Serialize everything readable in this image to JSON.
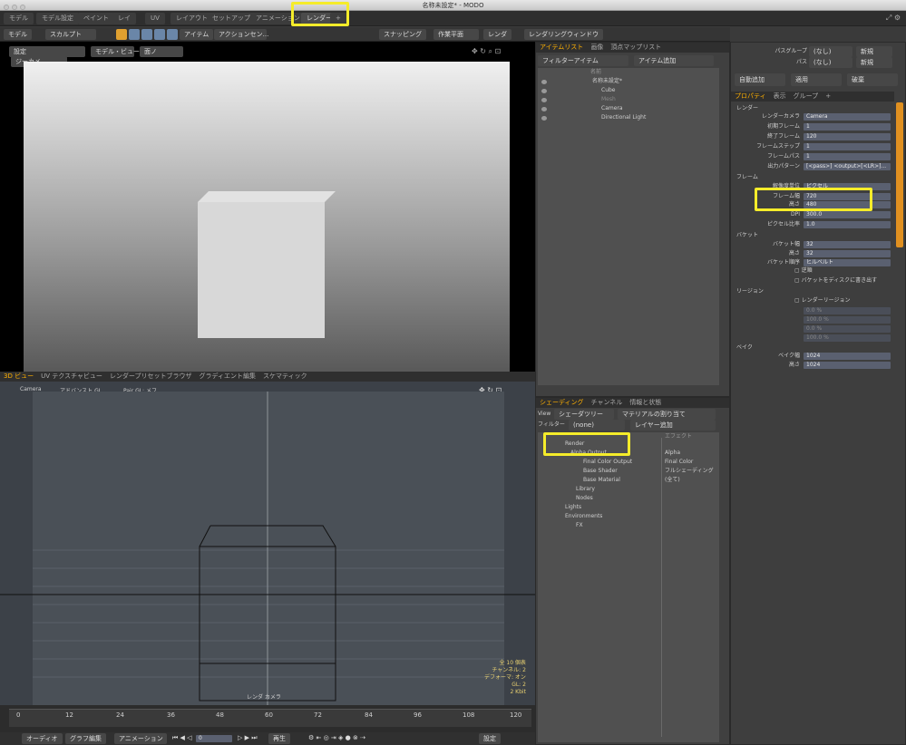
{
  "window": {
    "title": "名称未設定* - MODO"
  },
  "menu_tabs": [
    "モデル",
    "モデル設定",
    "ペイント",
    "レイ",
    "UV",
    "レイアウト",
    "セットアップ",
    "アニメーション",
    "レンダー",
    "+"
  ],
  "toolbar": {
    "model": "モデル",
    "sculpt": "スカルプト",
    "item": "アイテム",
    "action": "アクションセン...",
    "stepping": "スナッピング",
    "workplane": "作業平面",
    "render": "レンダ",
    "render_window": "レンダリングウィンドウ"
  },
  "viewport_top": {
    "tabs": [
      "設定",
      "モデル・ビュー",
      "面ノ",
      "ジーカメ"
    ]
  },
  "viewport_bottom": {
    "tabs": [
      "3D ビュー",
      "UV テクスチャビュー",
      "レンダープリセットブラウザ",
      "グラディエント編集",
      "スケマティック"
    ],
    "camera": "Camera",
    "mode": "アドバンスト GL",
    "fps": "Pair GL: メフ",
    "label": "レンダ カメラ",
    "info": [
      "全 10 個表",
      "チャンネル: 2",
      "デフォーマ: オン",
      "GL: 2",
      "2 Kbit"
    ]
  },
  "timeline": {
    "ticks": [
      "0",
      "12",
      "24",
      "36",
      "48",
      "60",
      "72",
      "84",
      "96",
      "108",
      "120"
    ],
    "controls": {
      "audio": "オーディオ",
      "graph": "グラフ編集",
      "animation": "アニメーション",
      "frame": "0",
      "play": "再生",
      "settings": "設定"
    }
  },
  "item_list": {
    "tabs": [
      "アイテムリスト",
      "画像",
      "頂点マップリスト"
    ],
    "filter": "フィルターアイテム",
    "add": "アイテム追加",
    "header": "名前",
    "items": [
      "名称未設定*",
      "Cube",
      "Mesh",
      "Camera",
      "Directional Light"
    ]
  },
  "shading": {
    "tabs": [
      "シェーディング",
      "チャンネル",
      "情報と状態"
    ],
    "view_label": "View",
    "view_value": "シェーダツリー",
    "assign": "マテリアルの割り当て",
    "filter_label": "フィルター",
    "filter_value": "(none)",
    "add_layer": "レイヤー追加",
    "effect_header": "エフェクト",
    "items": [
      {
        "name": "Render",
        "effect": ""
      },
      {
        "name": "Alpha Output",
        "effect": "Alpha"
      },
      {
        "name": "Final Color Output",
        "effect": "Final Color"
      },
      {
        "name": "Base Shader",
        "effect": "フルシェーディング"
      },
      {
        "name": "Base Material",
        "effect": "(全て)"
      },
      {
        "name": "Library",
        "effect": ""
      },
      {
        "name": "Nodes",
        "effect": ""
      },
      {
        "name": "Lights",
        "effect": ""
      },
      {
        "name": "Environments",
        "effect": ""
      },
      {
        "name": "FX",
        "effect": ""
      }
    ]
  },
  "properties": {
    "top": {
      "pass_group": "パスグループ",
      "pass": "パス",
      "none1": "(なし)",
      "none2": "(なし)",
      "new": "新規",
      "new2": "新規",
      "auto_add": "自動追加",
      "apply": "適用",
      "discard": "破棄"
    },
    "tabs": [
      "プロパティ",
      "表示",
      "グループ",
      "+"
    ],
    "render_section": "レンダー",
    "render_camera_label": "レンダーカメラ",
    "render_camera": "Camera",
    "first_frame_label": "初期フレーム",
    "first_frame": "1",
    "last_frame_label": "終了フレーム",
    "last_frame": "120",
    "frame_step_label": "フレームステップ",
    "frame_step": "1",
    "frame_pass_label": "フレームパス",
    "frame_pass": "1",
    "output_pattern_label": "出力パターン",
    "output_pattern": "[<pass>] <output>[<LR>]...",
    "frame_section": "フレーム",
    "res_unit_label": "解像度単位",
    "res_unit": "ピクセル",
    "width_label": "フレーム幅",
    "width": "720",
    "height_label": "高さ",
    "height": "480",
    "dpi_label": "DPI",
    "dpi": "300.0",
    "pixel_ratio_label": "ピクセル比率",
    "pixel_ratio": "1.0",
    "bucket_section": "バケット",
    "bucket_w_label": "バケット幅",
    "bucket_w": "32",
    "bucket_h_label": "高さ",
    "bucket_h": "32",
    "bucket_order_label": "バケット順序",
    "bucket_order": "ヒルベルト",
    "reverse": "逆順",
    "write_disk": "バケットをディスクに書き出す",
    "region_section": "リージョン",
    "render_region": "レンダーリージョン",
    "region_vals": [
      "0.0 %",
      "100.0 %",
      "0.0 %",
      "100.0 %"
    ],
    "bake_section": "ベイク",
    "bake_w_label": "ベイク幅",
    "bake_w": "1024",
    "bake_h_label": "高さ",
    "bake_h": "1024"
  },
  "colors": {
    "highlight": "#f5ec2a",
    "accent": "#ffb000"
  }
}
